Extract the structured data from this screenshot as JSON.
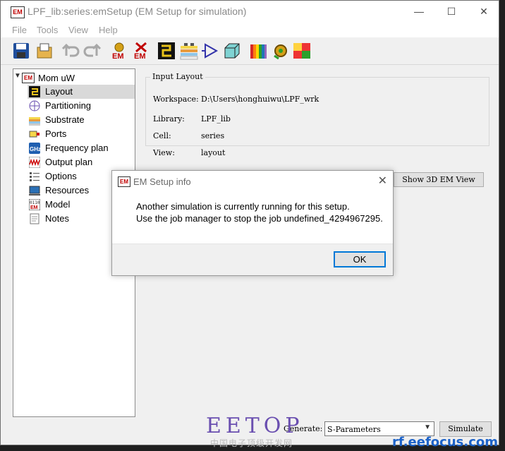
{
  "window": {
    "title": "LPF_lib:series:emSetup (EM Setup for simulation)",
    "app_icon": "EM",
    "controls": [
      "—",
      "☐",
      "✕"
    ]
  },
  "menu": [
    "File",
    "Tools",
    "View",
    "Help"
  ],
  "toolbar": {
    "icons": [
      "save-icon",
      "open-icon",
      "undo-icon",
      "redo-icon",
      "em-simulate-icon",
      "em-stop-icon",
      "layout-icon",
      "substrate-icon",
      "schematic-icon",
      "3d-box-icon",
      "spectrum-icon",
      "gear-icon",
      "heatmap-icon"
    ],
    "em_label": "EM"
  },
  "tree": {
    "root": "Mom uW",
    "items": [
      {
        "label": "Layout",
        "icon": "layout-icon",
        "selected": true
      },
      {
        "label": "Partitioning",
        "icon": "partitioning-icon"
      },
      {
        "label": "Substrate",
        "icon": "substrate-icon"
      },
      {
        "label": "Ports",
        "icon": "ports-icon"
      },
      {
        "label": "Frequency plan",
        "icon": "ghz-icon"
      },
      {
        "label": "Output plan",
        "icon": "output-plan-icon"
      },
      {
        "label": "Options",
        "icon": "options-icon"
      },
      {
        "label": "Resources",
        "icon": "resources-icon"
      },
      {
        "label": "Model",
        "icon": "model-icon"
      },
      {
        "label": "Notes",
        "icon": "notes-icon"
      }
    ]
  },
  "input_layout": {
    "title": "Input Layout",
    "workspace_label": "Workspace:",
    "workspace_value": "D:\\Users\\honghuiwu\\LPF_wrk",
    "library_label": "Library:",
    "library_value": "LPF_lib",
    "cell_label": "Cell:",
    "cell_value": "series",
    "view_label": "View:",
    "view_value": "layout"
  },
  "show3d_button": "Show 3D EM View",
  "dialog": {
    "title": "EM Setup info",
    "line1": "Another simulation is currently running for this setup.",
    "line2": "Use the job manager to stop the job undefined_4294967295.",
    "ok": "OK"
  },
  "footer": {
    "generate_label": "Generate:",
    "generate_value": "S-Parameters",
    "simulate": "Simulate"
  },
  "watermark": {
    "brand": "EETOP",
    "cn": "中国电子顶级开发网",
    "rf": "rf.eefocus.com"
  }
}
